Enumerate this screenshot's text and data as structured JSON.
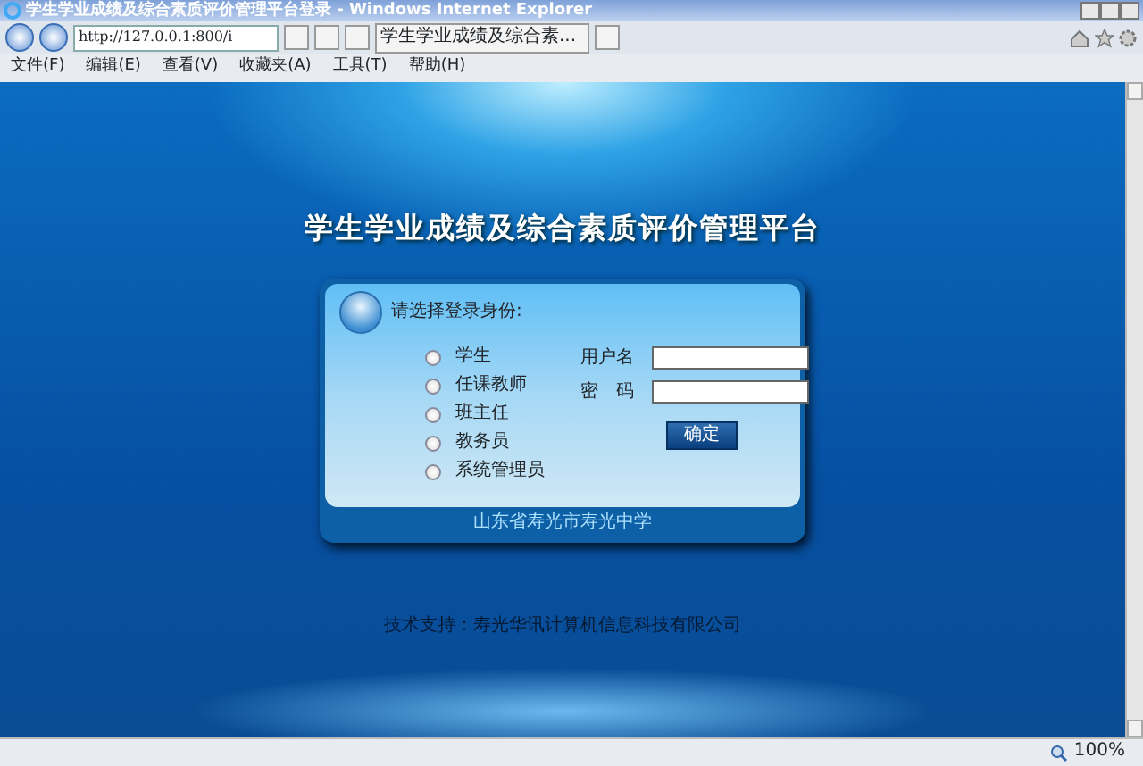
{
  "window": {
    "title": "学生学业成绩及综合素质评价管理平台登录 - Windows Internet Explorer"
  },
  "address_bar": {
    "url": "http://127.0.0.1:800/i"
  },
  "tab": {
    "label": "学生学业成绩及综合素..."
  },
  "menu": [
    "文件(F)",
    "编辑(E)",
    "查看(V)",
    "收藏夹(A)",
    "工具(T)",
    "帮助(H)"
  ],
  "page": {
    "heading": "学生学业成绩及综合素质评价管理平台",
    "login": {
      "prompt": "请选择登录身份:",
      "roles": [
        {
          "label": "学生",
          "selected": false
        },
        {
          "label": "任课教师",
          "selected": false
        },
        {
          "label": "班主任",
          "selected": false
        },
        {
          "label": "教务员",
          "selected": false
        },
        {
          "label": "系统管理员",
          "selected": false
        }
      ],
      "username_label": "用户名",
      "password_label": "密　码",
      "submit": "确定",
      "school": "山东省寿光市寿光中学"
    },
    "footer": "技术支持：寿光华讯计算机信息科技有限公司"
  },
  "status_bar": {
    "zoom": "100%"
  }
}
